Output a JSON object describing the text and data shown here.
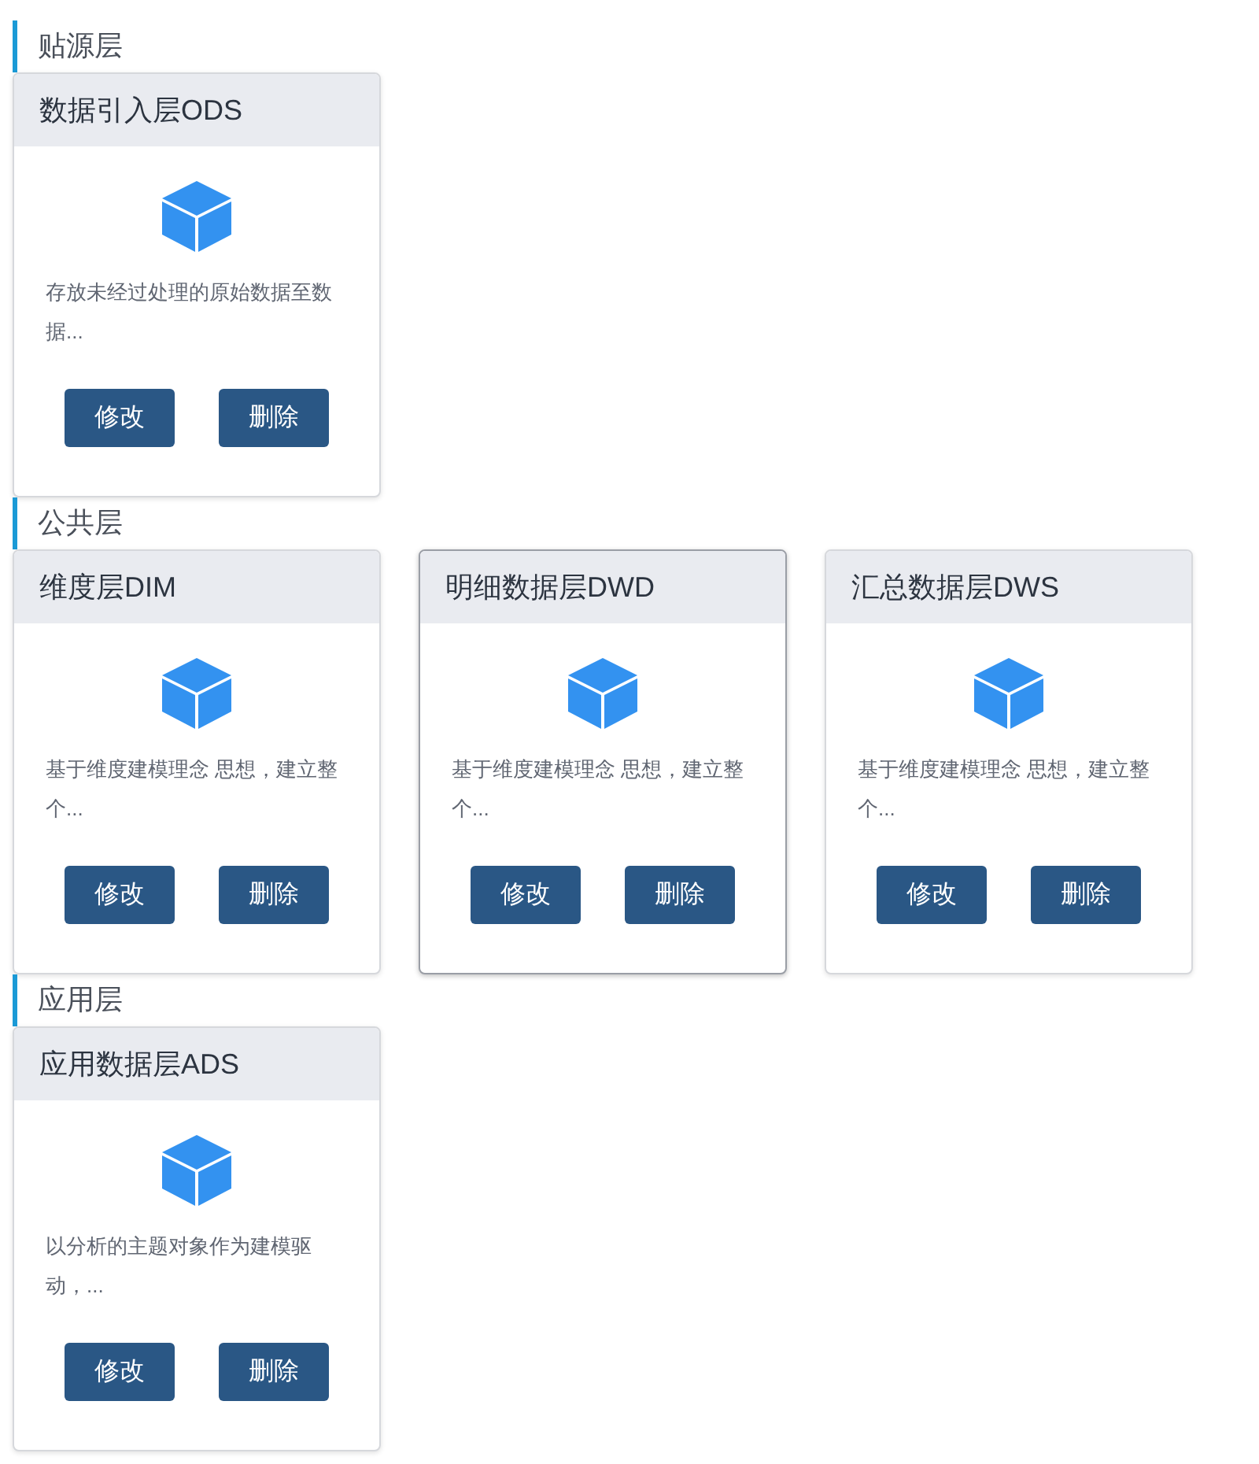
{
  "sections": [
    {
      "title": "贴源层",
      "cards": [
        {
          "title": "数据引入层ODS",
          "description": "存放未经过处理的原始数据至数据...",
          "highlighted": false,
          "buttons": [
            "修改",
            "删除"
          ]
        }
      ]
    },
    {
      "title": "公共层",
      "cards": [
        {
          "title": "维度层DIM",
          "description": "基于维度建模理念 思想，建立整个...",
          "highlighted": false,
          "buttons": [
            "修改",
            "删除"
          ]
        },
        {
          "title": "明细数据层DWD",
          "description": "基于维度建模理念 思想，建立整个...",
          "highlighted": true,
          "buttons": [
            "修改",
            "删除"
          ]
        },
        {
          "title": "汇总数据层DWS",
          "description": "基于维度建模理念 思想，建立整个...",
          "highlighted": false,
          "buttons": [
            "修改",
            "删除"
          ]
        }
      ]
    },
    {
      "title": "应用层",
      "cards": [
        {
          "title": "应用数据层ADS",
          "description": "以分析的主题对象作为建模驱动，...",
          "highlighted": false,
          "buttons": [
            "修改",
            "删除"
          ]
        }
      ]
    }
  ]
}
